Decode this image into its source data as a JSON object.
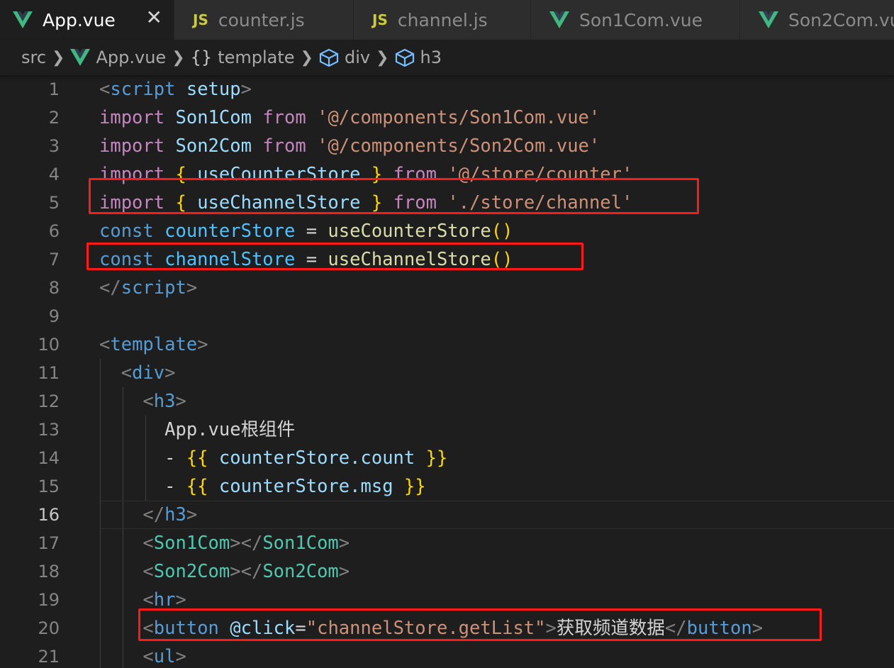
{
  "tabs": [
    {
      "label": "App.vue",
      "icon": "vue-icon",
      "active": true,
      "close": "✕"
    },
    {
      "label": "counter.js",
      "icon": "js-icon",
      "badge": "JS"
    },
    {
      "label": "channel.js",
      "icon": "js-icon",
      "badge": "JS"
    },
    {
      "label": "Son1Com.vue",
      "icon": "vue-icon"
    },
    {
      "label": "Son2Com.vu",
      "icon": "vue-icon"
    }
  ],
  "breadcrumb": {
    "src": "src",
    "file": "App.vue",
    "template_icon": "{}",
    "template": "template",
    "div": "div",
    "h3": "h3"
  },
  "editor": {
    "active_line": 16,
    "lines": [
      {
        "n": "1",
        "tokens": [
          [
            "t-punc",
            "<"
          ],
          [
            "t-tag",
            "script"
          ],
          [
            "t-text",
            " "
          ],
          [
            "t-attr",
            "setup"
          ],
          [
            "t-punc",
            ">"
          ]
        ]
      },
      {
        "n": "2",
        "tokens": [
          [
            "t-kw",
            "import"
          ],
          [
            "t-text",
            " "
          ],
          [
            "t-var",
            "Son1Com"
          ],
          [
            "t-text",
            " "
          ],
          [
            "t-kw",
            "from"
          ],
          [
            "t-text",
            " "
          ],
          [
            "t-str",
            "'@/components/Son1Com.vue'"
          ]
        ]
      },
      {
        "n": "3",
        "tokens": [
          [
            "t-kw",
            "import"
          ],
          [
            "t-text",
            " "
          ],
          [
            "t-var",
            "Son2Com"
          ],
          [
            "t-text",
            " "
          ],
          [
            "t-kw",
            "from"
          ],
          [
            "t-text",
            " "
          ],
          [
            "t-str",
            "'@/components/Son2Com.vue'"
          ]
        ]
      },
      {
        "n": "4",
        "tokens": [
          [
            "t-kw",
            "import"
          ],
          [
            "t-text",
            " "
          ],
          [
            "t-brace",
            "{"
          ],
          [
            "t-text",
            " "
          ],
          [
            "t-var",
            "useCounterStore"
          ],
          [
            "t-text",
            " "
          ],
          [
            "t-brace",
            "}"
          ],
          [
            "t-text",
            " "
          ],
          [
            "t-kw",
            "from"
          ],
          [
            "t-text",
            " "
          ],
          [
            "t-str",
            "'@/store/counter'"
          ]
        ]
      },
      {
        "n": "5",
        "tokens": [
          [
            "t-kw",
            "import"
          ],
          [
            "t-text",
            " "
          ],
          [
            "t-brace",
            "{"
          ],
          [
            "t-text",
            " "
          ],
          [
            "t-var",
            "useChannelStore"
          ],
          [
            "t-text",
            " "
          ],
          [
            "t-brace",
            "}"
          ],
          [
            "t-text",
            " "
          ],
          [
            "t-kw",
            "from"
          ],
          [
            "t-text",
            " "
          ],
          [
            "t-str",
            "'./store/channel'"
          ]
        ]
      },
      {
        "n": "6",
        "tokens": [
          [
            "t-const",
            "const"
          ],
          [
            "t-text",
            " "
          ],
          [
            "t-cvar",
            "counterStore"
          ],
          [
            "t-op",
            " = "
          ],
          [
            "t-fn",
            "useCounterStore"
          ],
          [
            "t-brace",
            "()"
          ]
        ]
      },
      {
        "n": "7",
        "tokens": [
          [
            "t-const",
            "const"
          ],
          [
            "t-text",
            " "
          ],
          [
            "t-cvar",
            "channelStore"
          ],
          [
            "t-op",
            " = "
          ],
          [
            "t-fn",
            "useChannelStore"
          ],
          [
            "t-brace",
            "()"
          ]
        ]
      },
      {
        "n": "8",
        "tokens": [
          [
            "t-punc",
            "</"
          ],
          [
            "t-tag",
            "script"
          ],
          [
            "t-punc",
            ">"
          ]
        ]
      },
      {
        "n": "9",
        "tokens": []
      },
      {
        "n": "10",
        "tokens": [
          [
            "t-punc",
            "<"
          ],
          [
            "t-tag",
            "template"
          ],
          [
            "t-punc",
            ">"
          ]
        ]
      },
      {
        "n": "11",
        "tokens": [
          [
            "t-text",
            "  "
          ],
          [
            "t-punc",
            "<"
          ],
          [
            "t-tag",
            "div"
          ],
          [
            "t-punc",
            ">"
          ]
        ]
      },
      {
        "n": "12",
        "tokens": [
          [
            "t-text",
            "    "
          ],
          [
            "t-punc",
            "<"
          ],
          [
            "t-tag",
            "h3"
          ],
          [
            "t-punc",
            ">"
          ]
        ]
      },
      {
        "n": "13",
        "tokens": [
          [
            "t-text",
            "      App.vue根组件"
          ]
        ]
      },
      {
        "n": "14",
        "tokens": [
          [
            "t-text",
            "      - "
          ],
          [
            "t-brace",
            "{{"
          ],
          [
            "t-text",
            " "
          ],
          [
            "t-var",
            "counterStore.count"
          ],
          [
            "t-text",
            " "
          ],
          [
            "t-brace",
            "}}"
          ]
        ]
      },
      {
        "n": "15",
        "tokens": [
          [
            "t-text",
            "      - "
          ],
          [
            "t-brace",
            "{{"
          ],
          [
            "t-text",
            " "
          ],
          [
            "t-var",
            "counterStore.msg"
          ],
          [
            "t-text",
            " "
          ],
          [
            "t-brace",
            "}}"
          ]
        ]
      },
      {
        "n": "16",
        "tokens": [
          [
            "t-text",
            "    "
          ],
          [
            "t-punc",
            "</"
          ],
          [
            "t-tag",
            "h3"
          ],
          [
            "t-punc",
            ">"
          ]
        ]
      },
      {
        "n": "17",
        "tokens": [
          [
            "t-text",
            "    "
          ],
          [
            "t-punc",
            "<"
          ],
          [
            "t-comp",
            "Son1Com"
          ],
          [
            "t-punc",
            "></"
          ],
          [
            "t-comp",
            "Son1Com"
          ],
          [
            "t-punc",
            ">"
          ]
        ]
      },
      {
        "n": "18",
        "tokens": [
          [
            "t-text",
            "    "
          ],
          [
            "t-punc",
            "<"
          ],
          [
            "t-comp",
            "Son2Com"
          ],
          [
            "t-punc",
            "></"
          ],
          [
            "t-comp",
            "Son2Com"
          ],
          [
            "t-punc",
            ">"
          ]
        ]
      },
      {
        "n": "19",
        "tokens": [
          [
            "t-text",
            "    "
          ],
          [
            "t-punc",
            "<"
          ],
          [
            "t-tag",
            "hr"
          ],
          [
            "t-punc",
            ">"
          ]
        ]
      },
      {
        "n": "20",
        "tokens": [
          [
            "t-text",
            "    "
          ],
          [
            "t-punc",
            "<"
          ],
          [
            "t-tag",
            "button"
          ],
          [
            "t-text",
            " "
          ],
          [
            "t-attr",
            "@click"
          ],
          [
            "t-op",
            "="
          ],
          [
            "t-str",
            "\"channelStore.getList\""
          ],
          [
            "t-punc",
            ">"
          ],
          [
            "t-text",
            "获取频道数据"
          ],
          [
            "t-punc",
            "</"
          ],
          [
            "t-tag",
            "button"
          ],
          [
            "t-punc",
            ">"
          ]
        ]
      },
      {
        "n": "21",
        "tokens": [
          [
            "t-text",
            "    "
          ],
          [
            "t-punc",
            "<"
          ],
          [
            "t-tag",
            "ul"
          ],
          [
            "t-punc",
            ">"
          ]
        ]
      }
    ]
  },
  "highlight_color": "#ff1a1a"
}
